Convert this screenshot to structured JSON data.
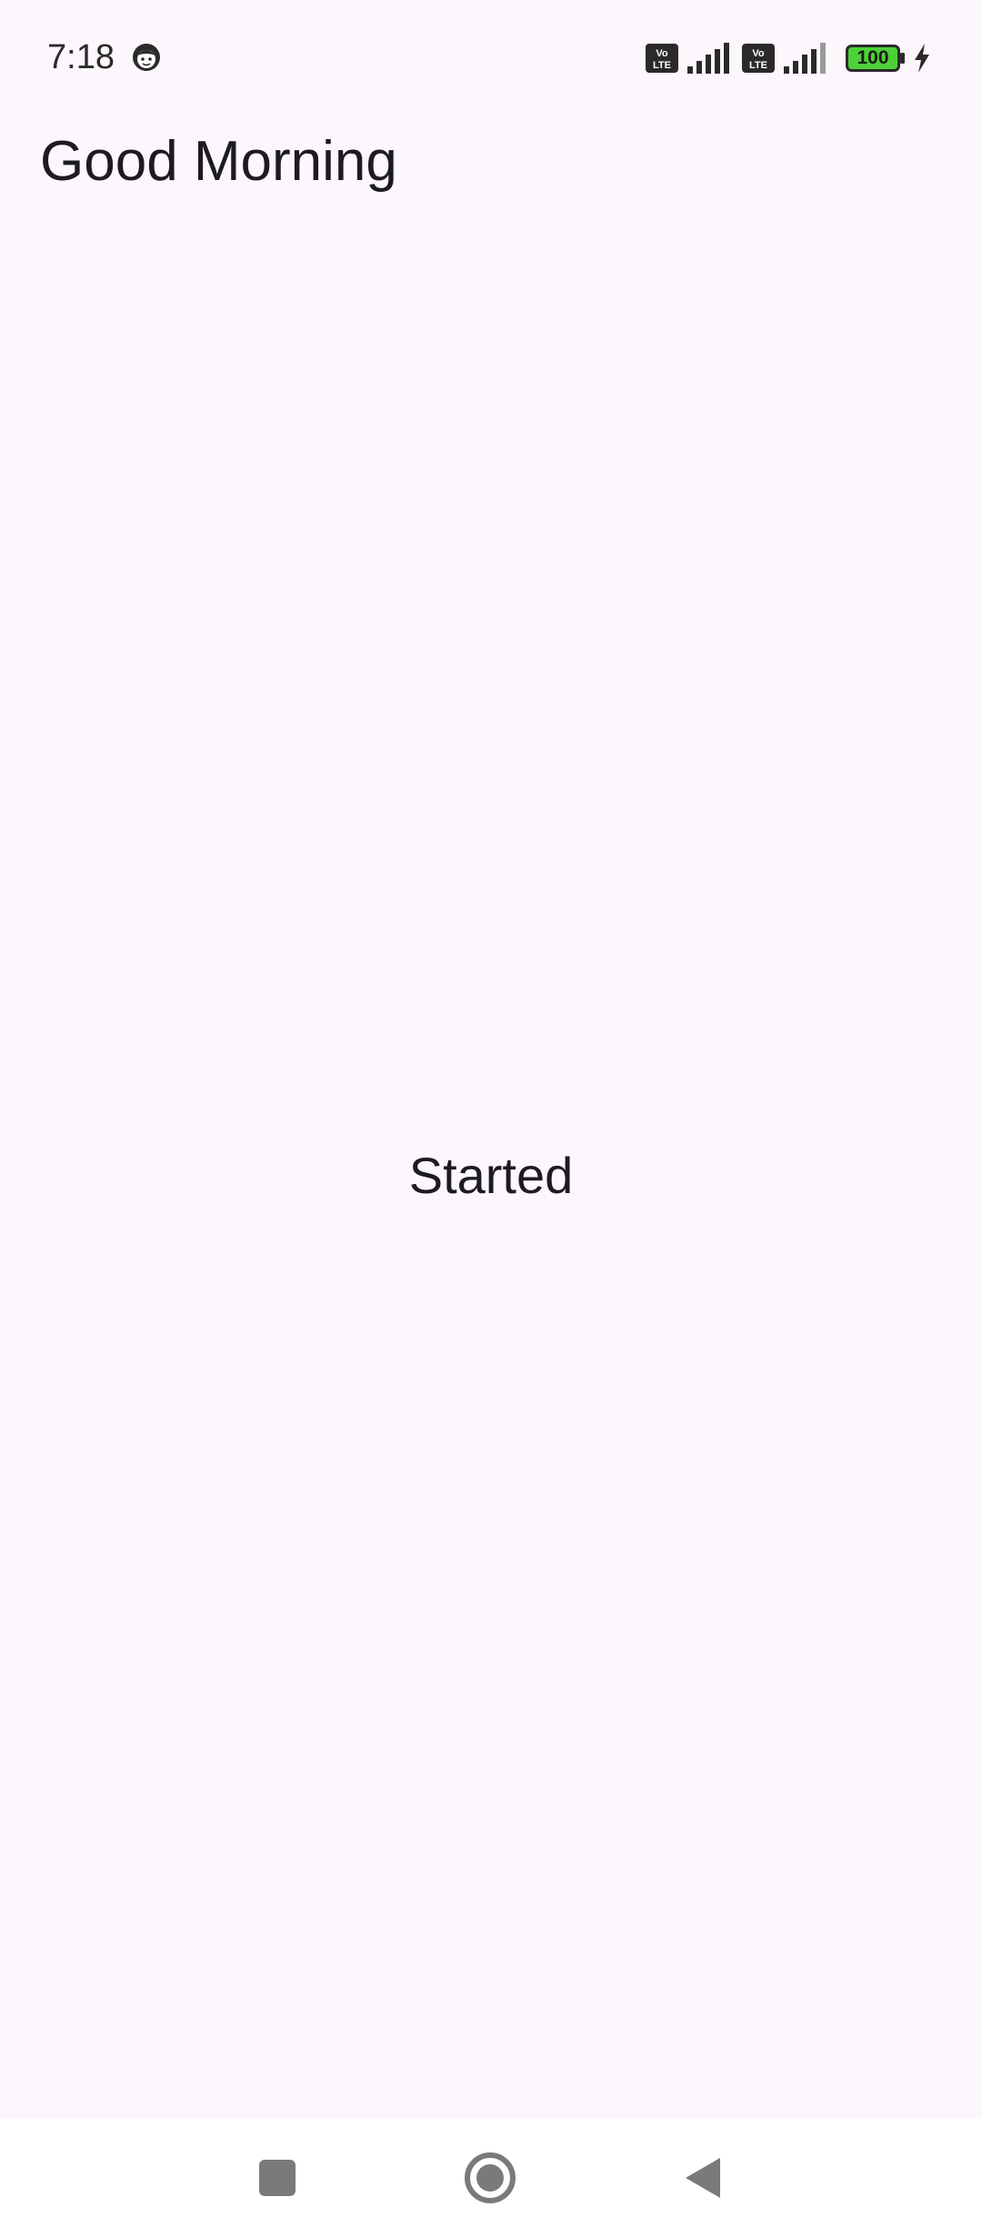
{
  "status_bar": {
    "time": "7:18",
    "battery_level": "100",
    "icons": [
      "face-icon",
      "volte-icon",
      "signal-icon",
      "volte-icon",
      "signal-icon",
      "battery-icon",
      "charging-bolt-icon"
    ],
    "battery_color": "#4cd137"
  },
  "header": {
    "title": "Good Morning"
  },
  "main": {
    "status_text": "Started"
  },
  "navigation": {
    "buttons": [
      "recents-button",
      "home-button",
      "back-button"
    ],
    "icon_color": "#7a7a7a"
  },
  "theme": {
    "background": "#fdf7fd",
    "nav_background": "#ffffff",
    "text_color": "#1c1b1f"
  }
}
